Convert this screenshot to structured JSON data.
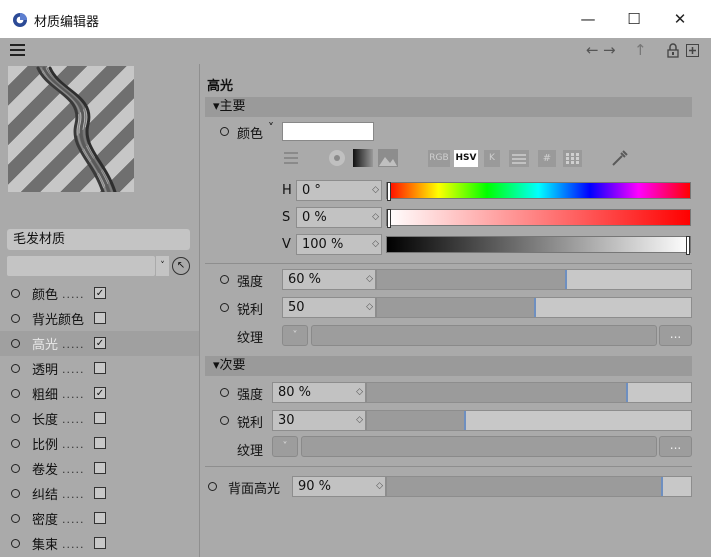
{
  "window": {
    "title": "材质编辑器",
    "minimize": "—",
    "maximize": "☐",
    "close": "✕",
    "accent": "#3b5aa8"
  },
  "toolbar": {
    "menu_icon": "hamburger-icon",
    "back": "←",
    "forward": "→",
    "up": "↑",
    "lock": "🔒",
    "new": "⊞"
  },
  "left": {
    "material_name": "毛发材质",
    "channels": [
      {
        "label": "颜色",
        "checked": true,
        "glyph": "✓"
      },
      {
        "label": "背光颜色",
        "checked": false,
        "glyph": ""
      },
      {
        "label": "高光",
        "checked": true,
        "glyph": "✓"
      },
      {
        "label": "透明",
        "checked": false,
        "glyph": ""
      },
      {
        "label": "粗细",
        "checked": true,
        "glyph": "✓"
      },
      {
        "label": "长度",
        "checked": false,
        "glyph": ""
      },
      {
        "label": "比例",
        "checked": false,
        "glyph": ""
      },
      {
        "label": "卷发",
        "checked": false,
        "glyph": ""
      },
      {
        "label": "纠结",
        "checked": false,
        "glyph": ""
      },
      {
        "label": "密度",
        "checked": false,
        "glyph": ""
      },
      {
        "label": "集束",
        "checked": false,
        "glyph": ""
      }
    ],
    "dots": "....."
  },
  "right": {
    "section_title": "高光",
    "main_group": "▾主要",
    "color_label": "颜色",
    "color_chevron": "˅",
    "color_value": "#ffffff",
    "mode_rgb": "RGB",
    "mode_hsv": "HSV",
    "mode_k": "K",
    "mode_hash": "#",
    "h_label": "H",
    "h_value": "0 °",
    "s_label": "S",
    "s_value": "0 %",
    "v_label": "V",
    "v_value": "100 %",
    "strength_label": "强度",
    "strength_value": "60 %",
    "strength_fraction": 0.6,
    "sharp_label": "锐利",
    "sharp_value": "50",
    "sharp_fraction": 0.5,
    "texture_label": "纹理",
    "sub_group": "▾次要",
    "strength2_label": "强度",
    "strength2_value": "80 %",
    "strength2_fraction": 0.8,
    "sharp2_label": "锐利",
    "sharp2_value": "30",
    "sharp2_fraction": 0.3,
    "texture2_label": "纹理",
    "back_label": "背面高光",
    "back_value": "90 %",
    "back_fraction": 0.9,
    "more": "...",
    "spin": "◇",
    "drop": "˅"
  }
}
